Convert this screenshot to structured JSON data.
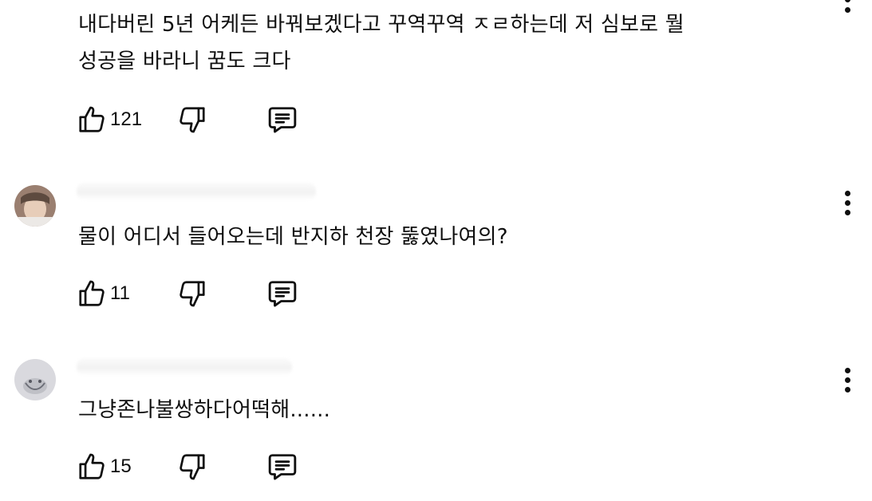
{
  "comments": [
    {
      "text_lines": [
        "내다버린 5년 어케든 바꿔보겠다고 꾸역꾸역 ㅈㄹ하는데 저 심보로 뭘",
        "성공을 바라니 꿈도 크다"
      ],
      "likes": "121"
    },
    {
      "text_lines": [
        "물이 어디서 들어오는데 반지하 천장 뚫였나여의?"
      ],
      "likes": "11"
    },
    {
      "text_lines": [
        "그냥존나불쌍하다어떡해......"
      ],
      "likes": "15"
    }
  ],
  "icons": {
    "like": "thumbs-up-icon",
    "dislike": "thumbs-down-icon",
    "reply": "comment-icon",
    "menu": "more-vert-icon"
  },
  "colors": {
    "text": "#0f0f0f",
    "background": "#ffffff"
  }
}
